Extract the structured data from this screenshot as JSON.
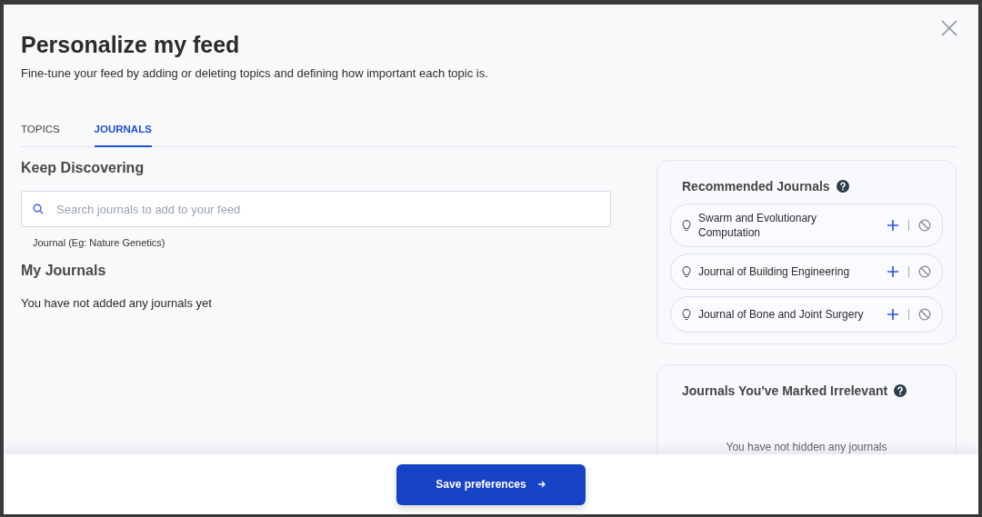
{
  "dialog": {
    "title": "Personalize my feed",
    "subtitle": "Fine-tune your feed by adding or deleting topics and defining how important each topic is."
  },
  "tabs": [
    {
      "label": "TOPICS",
      "selected": false
    },
    {
      "label": "JOURNALS",
      "selected": true
    }
  ],
  "keep_discovering": {
    "heading": "Keep Discovering",
    "search": {
      "placeholder": "Search journals to add to your feed"
    },
    "hint": "Journal (Eg: Nature Genetics)"
  },
  "my_journals": {
    "heading": "My Journals",
    "empty_text": "You have not added any journals yet"
  },
  "recommended": {
    "heading": "Recommended Journals",
    "journals": [
      {
        "name": "Swarm and Evolutionary Computation"
      },
      {
        "name": "Journal of Building Engineering"
      },
      {
        "name": "Journal of Bone and Joint Surgery"
      }
    ]
  },
  "irrelevant": {
    "heading": "Journals You've Marked Irrelevant",
    "empty_text": "You have not hidden any journals"
  },
  "footer": {
    "button": "Save preferences"
  }
}
